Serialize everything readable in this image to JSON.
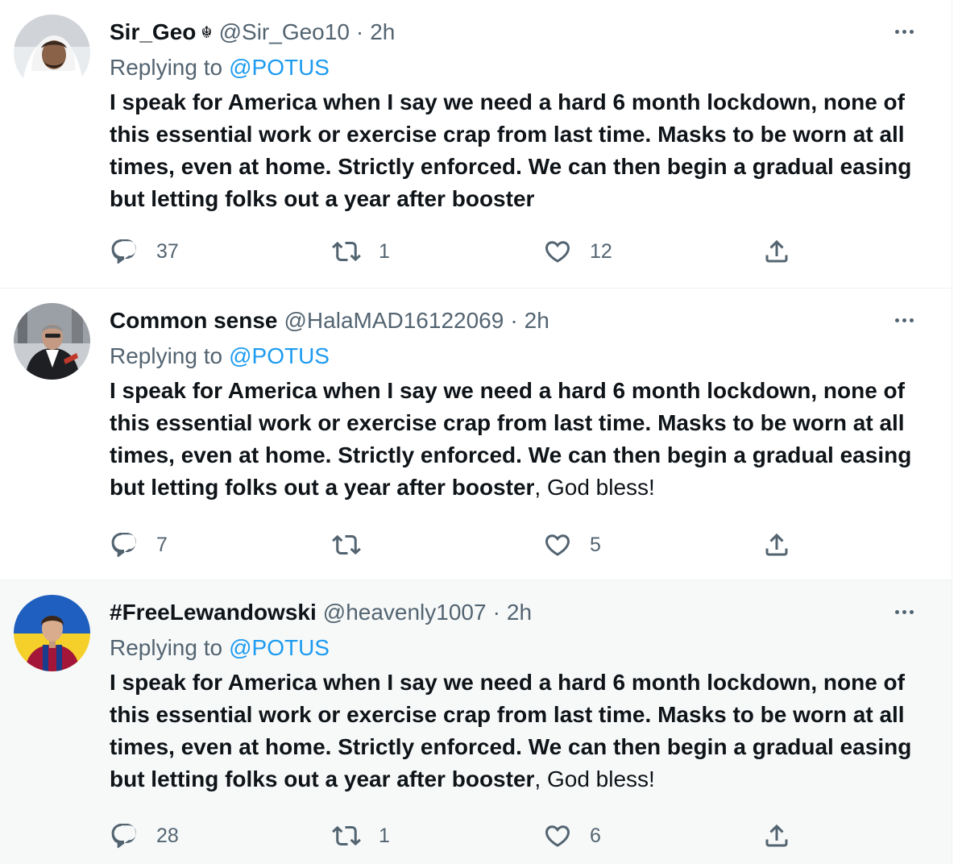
{
  "tweets": [
    {
      "display_name": "Sir_Geo",
      "badge_icon": "sikh-khanda-icon",
      "handle": "@Sir_Geo10",
      "separator": "·",
      "time": "2h",
      "replying_label": "Replying to",
      "replying_to": "@POTUS",
      "text_bold": "I speak for America when I say we need a hard 6 month lockdown, none of this essential work or exercise crap from last time. Masks to be worn at all times, even at home. Strictly enforced. We can then begin a gradual easing but letting folks out a year after booster",
      "text_regular": "",
      "reply_count": "37",
      "retweet_count": "1",
      "like_count": "12"
    },
    {
      "display_name": "Common sense",
      "handle": "@HalaMAD16122069",
      "separator": "·",
      "time": "2h",
      "replying_label": "Replying to",
      "replying_to": "@POTUS",
      "text_bold": "I speak for America when I say we need a hard 6 month lockdown, none of this essential work or exercise crap from last time. Masks to be worn at all times, even at home. Strictly enforced. We can then begin a gradual easing but letting folks out a year after booster",
      "text_regular": ", God bless!",
      "reply_count": "7",
      "retweet_count": "",
      "like_count": "5"
    },
    {
      "display_name": "#FreeLewandowski",
      "handle": "@heavenly1007",
      "separator": "·",
      "time": "2h",
      "replying_label": "Replying to",
      "replying_to": "@POTUS",
      "text_bold": "I speak for America when I say we need a hard 6 month lockdown, none of this essential work or exercise crap from last time. Masks to be worn at all times, even at home. Strictly enforced. We can then begin a gradual easing but letting folks out a year after booster",
      "text_regular": ", God bless!",
      "reply_count": "28",
      "retweet_count": "1",
      "like_count": "6"
    }
  ],
  "colors": {
    "text_primary": "#0f1419",
    "text_secondary": "#536471",
    "link": "#1d9bf0",
    "divider": "#eff3f4",
    "highlight_background": "#f7f9f9"
  },
  "icons": {
    "more": "more-horizontal-icon",
    "reply": "reply-bubble-icon",
    "retweet": "retweet-icon",
    "like": "heart-icon",
    "share": "share-icon"
  }
}
